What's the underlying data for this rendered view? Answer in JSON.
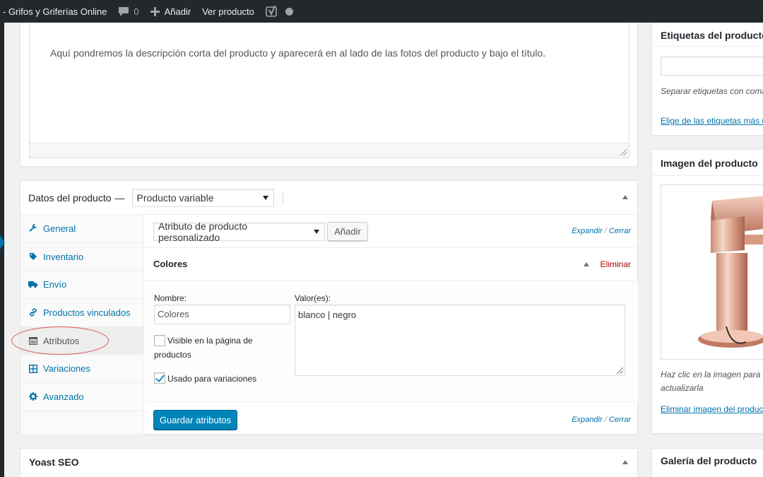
{
  "adminbar": {
    "site_name": "- Grifos y Griferías Online",
    "comments_count": "0",
    "new_label": "Añadir",
    "view_label": "Ver producto"
  },
  "excerpt": {
    "text": "Aquí pondremos la descripción corta del producto y aparecerá en al lado de las fotos del producto y bajo el título."
  },
  "product_data": {
    "title": "Datos del producto",
    "dash": "—",
    "type_selected": "Producto variable",
    "tabs": [
      {
        "label": "General",
        "icon": "wrench-icon"
      },
      {
        "label": "Inventario",
        "icon": "tag-icon"
      },
      {
        "label": "Envío",
        "icon": "truck-icon"
      },
      {
        "label": "Productos vinculados",
        "icon": "link-icon"
      },
      {
        "label": "Atributos",
        "icon": "list-view-icon"
      },
      {
        "label": "Variaciones",
        "icon": "grid-icon"
      },
      {
        "label": "Avanzado",
        "icon": "gear-icon"
      }
    ],
    "active_tab": "Atributos",
    "attributes": {
      "select_value": "Atributo de producto personalizado",
      "add_label": "Añadir",
      "expand_label": "Expandir",
      "separator": "/",
      "close_label": "Cerrar",
      "attribute_name_heading": "Colores",
      "delete_label": "Eliminar",
      "name_label": "Nombre:",
      "name_value": "Colores",
      "values_label": "Valor(es):",
      "values_value": "blanco | negro",
      "visible_label": "Visible en la página de productos",
      "visible_checked": false,
      "variations_label": "Usado para variaciones",
      "variations_checked": true,
      "save_label": "Guardar atributos"
    }
  },
  "yoast": {
    "title": "Yoast SEO"
  },
  "sidebar": {
    "tags": {
      "title": "Etiquetas del producto",
      "help": "Separar etiquetas con comas",
      "link": "Elige de las etiquetas más utilizadas"
    },
    "image": {
      "title": "Imagen del producto",
      "help_line1": "Haz clic en la imagen para editarla o",
      "help_line2": "actualizarla",
      "remove": "Eliminar imagen del producto"
    },
    "gallery": {
      "title": "Galería del producto"
    }
  },
  "colors": {
    "adminbar": "#23282d",
    "link": "#0073aa",
    "primary_button": "#0085ba",
    "delete": "#a00",
    "highlight_oval": "#d9534f"
  }
}
